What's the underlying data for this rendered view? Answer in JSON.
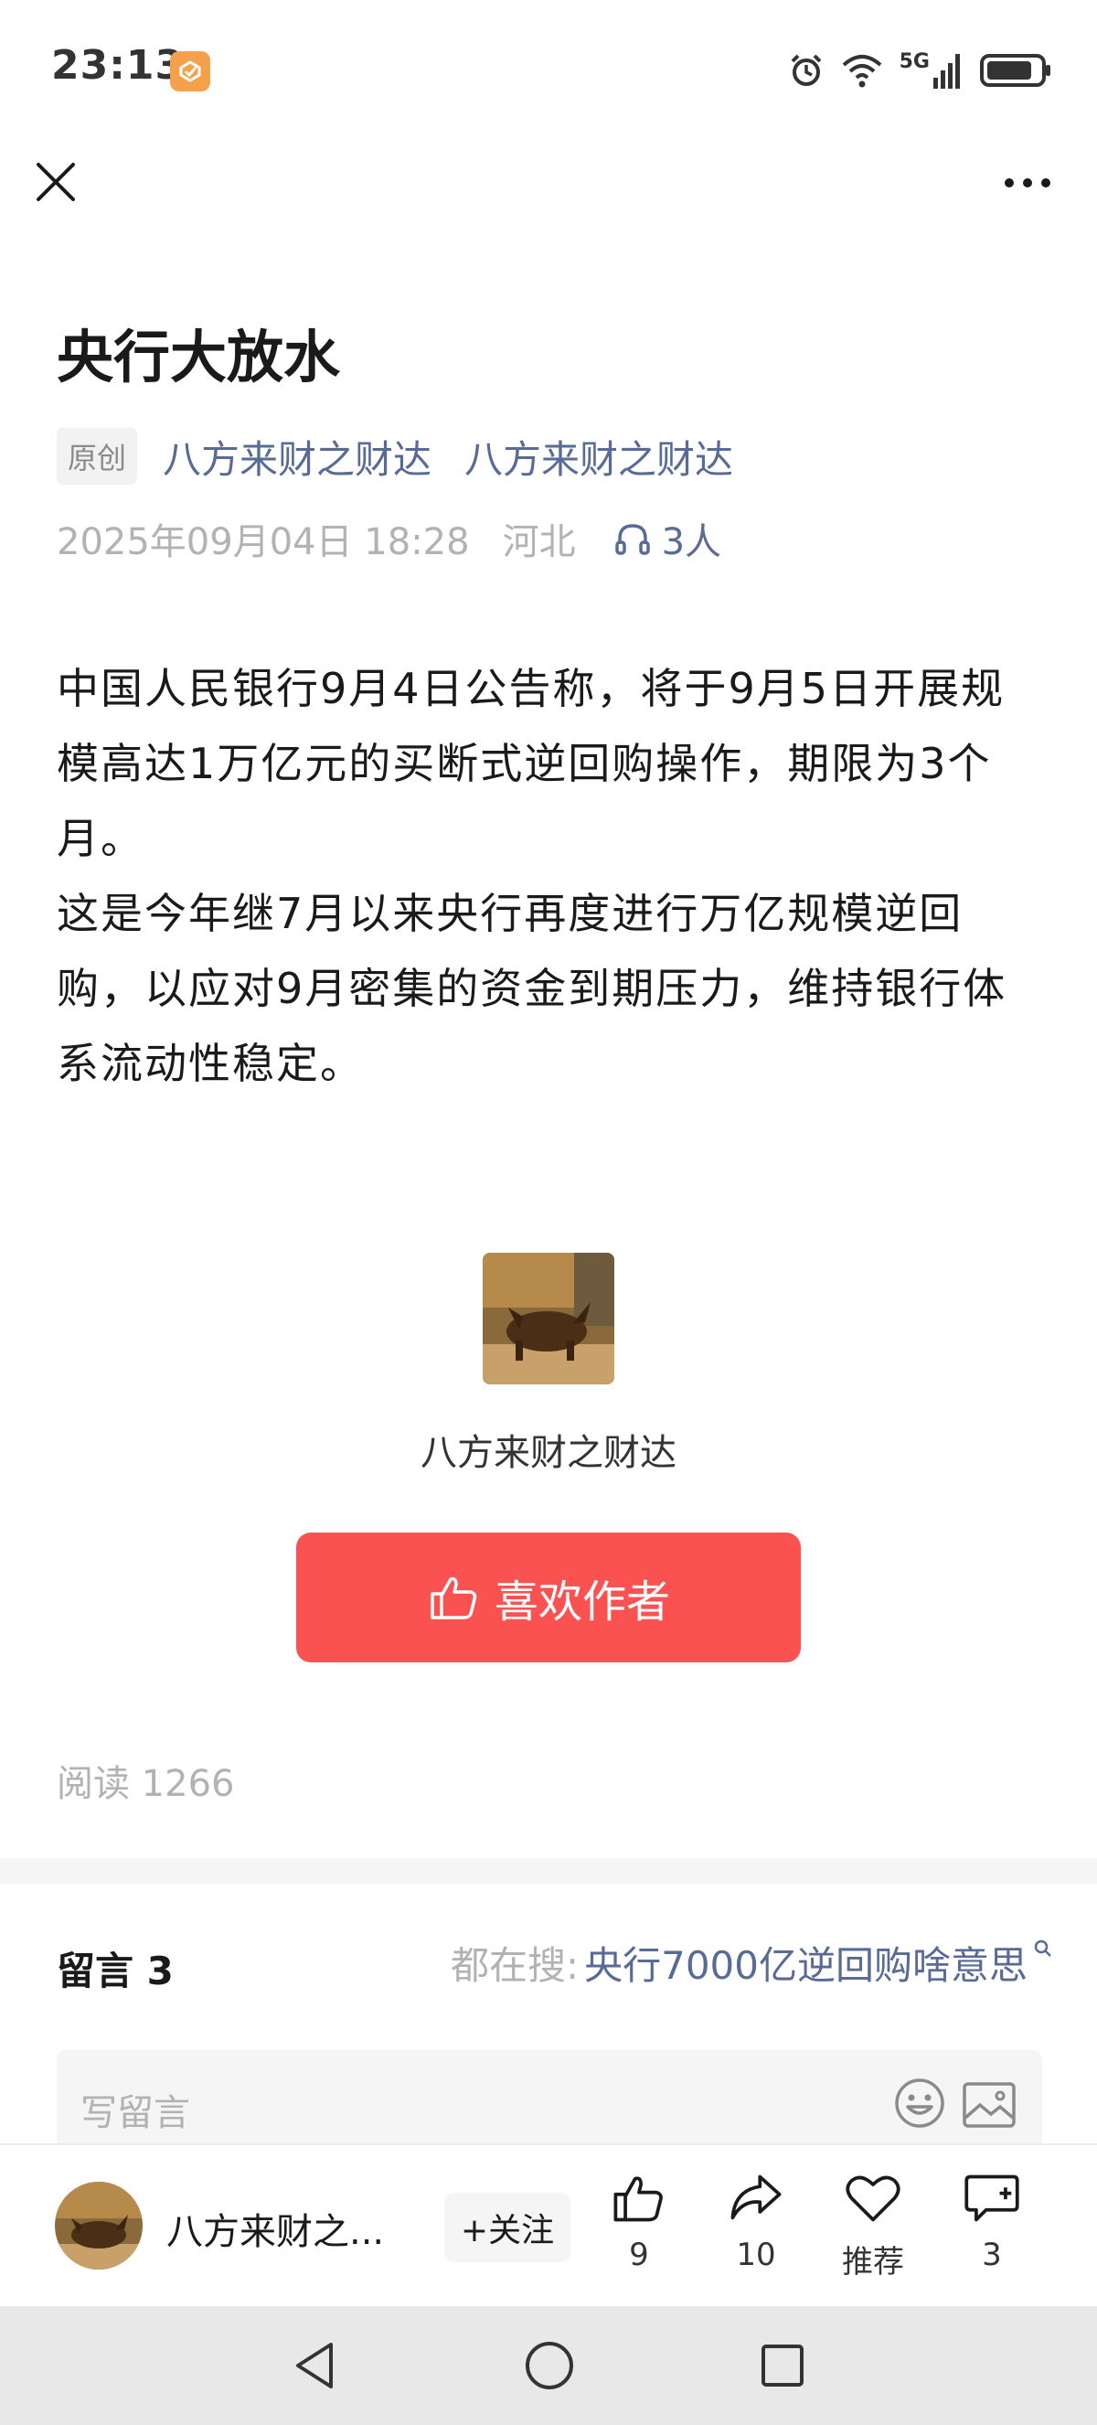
{
  "status_bar": {
    "time": "23:13",
    "network": "5G",
    "icons": [
      "app-badge-icon",
      "alarm-icon",
      "wifi-icon",
      "signal-icon",
      "battery-icon"
    ]
  },
  "nav": {
    "close_icon": "close-icon",
    "more_icon": "more-icon"
  },
  "article": {
    "title": "央行大放水",
    "badge": "原创",
    "author_link_1": "八方来财之财达",
    "author_link_2": "八方来财之财达",
    "date": "2025年09月04日 18:28",
    "location": "河北",
    "listeners": "3人",
    "paragraphs": [
      "中国人民银行9月4日公告称，将于9月5日开展规模高达1万亿元的买断式逆回购操作，期限为3个月。",
      "这是今年继7月以来央行再度进行万亿规模逆回购，以应对9月密集的资金到期压力，维持银行体系流动性稳定。"
    ],
    "author_name": "八方来财之财达",
    "like_author_label": "喜欢作者",
    "reads": "阅读 1266"
  },
  "comments": {
    "title": "留言 3",
    "search_label": "都在搜:",
    "search_query": "央行7000亿逆回购啥意思",
    "placeholder": "写留言"
  },
  "bottom_bar": {
    "author_short": "八方来财之...",
    "follow_label": "+关注",
    "likes": "9",
    "shares": "10",
    "recommend_label": "推荐",
    "comments_count": "3"
  },
  "colors": {
    "accent_red": "#fa5151",
    "link_blue": "#576b95",
    "muted_gray": "#b2b2b2"
  }
}
